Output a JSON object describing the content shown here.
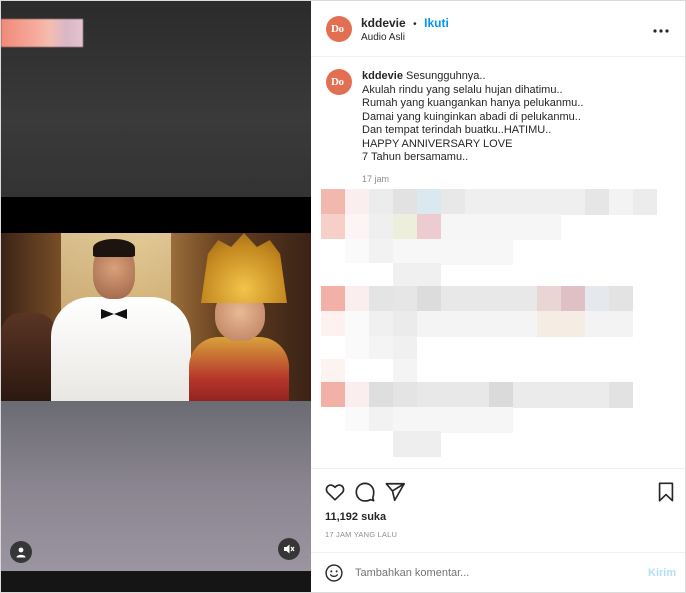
{
  "post": {
    "username": "kddevie",
    "separator": "•",
    "follow_label": "Ikuti",
    "audio_label": "Audio Asli",
    "avatar_text": "Do",
    "more_icon": "more-horizontal-icon"
  },
  "caption": {
    "username": "kddevie",
    "lines": [
      "Sesungguhnya..",
      "Akulah rindu yang selalu hujan dihatimu..",
      "Rumah yang kuangankan hanya pelukanmu..",
      "Damai yang kuinginkan abadi di pelukanmu..",
      "Dan tempat terindah buatku..HATIMU..",
      "HAPPY ANNIVERSARY LOVE",
      "7 Tahun bersamamu.."
    ],
    "time": "17 jam"
  },
  "actions": {
    "like_icon": "heart-icon",
    "comment_icon": "comment-icon",
    "share_icon": "send-icon",
    "save_icon": "bookmark-icon",
    "likes_text": "11,192 suka",
    "timestamp": "17 JAM YANG LALU"
  },
  "comment_box": {
    "emoji_icon": "smiley-icon",
    "placeholder": "Tambahkan komentar...",
    "submit_label": "Kirim"
  },
  "media": {
    "user_icon": "user-tag-icon",
    "mute_icon": "speaker-muted-icon"
  },
  "colors": {
    "accent_blue": "#0095f6",
    "avatar": "#e36f52",
    "text": "#262626",
    "muted": "#8e8e8e"
  }
}
